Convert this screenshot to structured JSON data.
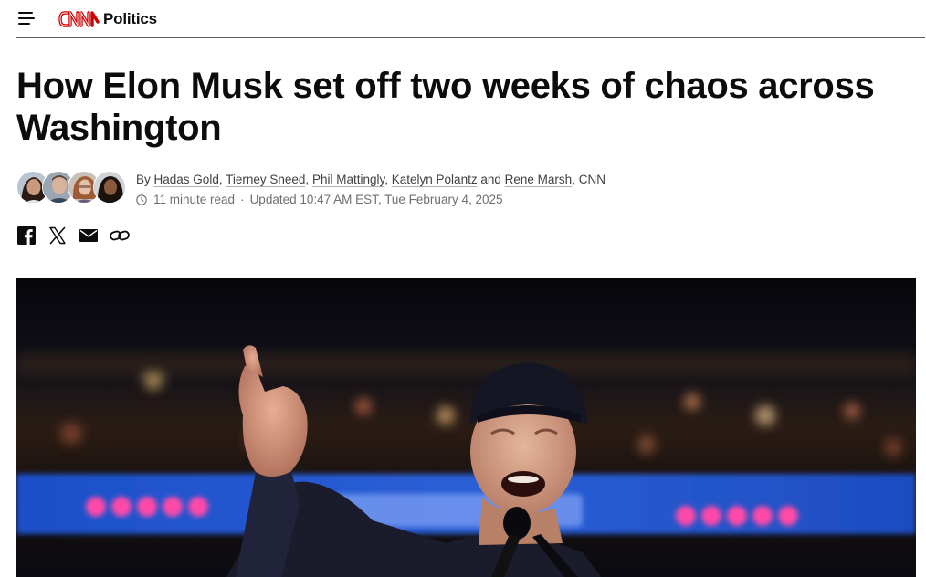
{
  "header": {
    "logo_text": "CNN",
    "section": "Politics",
    "menu_icon": "hamburger-menu-icon"
  },
  "article": {
    "headline": "How Elon Musk set off two weeks of chaos across Washington",
    "byline": {
      "prefix": "By",
      "authors": [
        "Hadas Gold",
        "Tierney Sneed",
        "Phil Mattingly",
        "Katelyn Polantz",
        "Rene Marsh"
      ],
      "separator": ",",
      "conjunction": "and",
      "outlet": "CNN"
    },
    "read_time": "11 minute read",
    "updated": "Updated 10:47 AM EST, Tue February 4, 2025"
  },
  "share": {
    "icons": [
      "facebook-icon",
      "x-icon",
      "email-icon",
      "link-icon"
    ]
  },
  "colors": {
    "brand_red": "#cc0000",
    "text": "#0c0c0c",
    "meta_text": "#6e6e6e"
  }
}
